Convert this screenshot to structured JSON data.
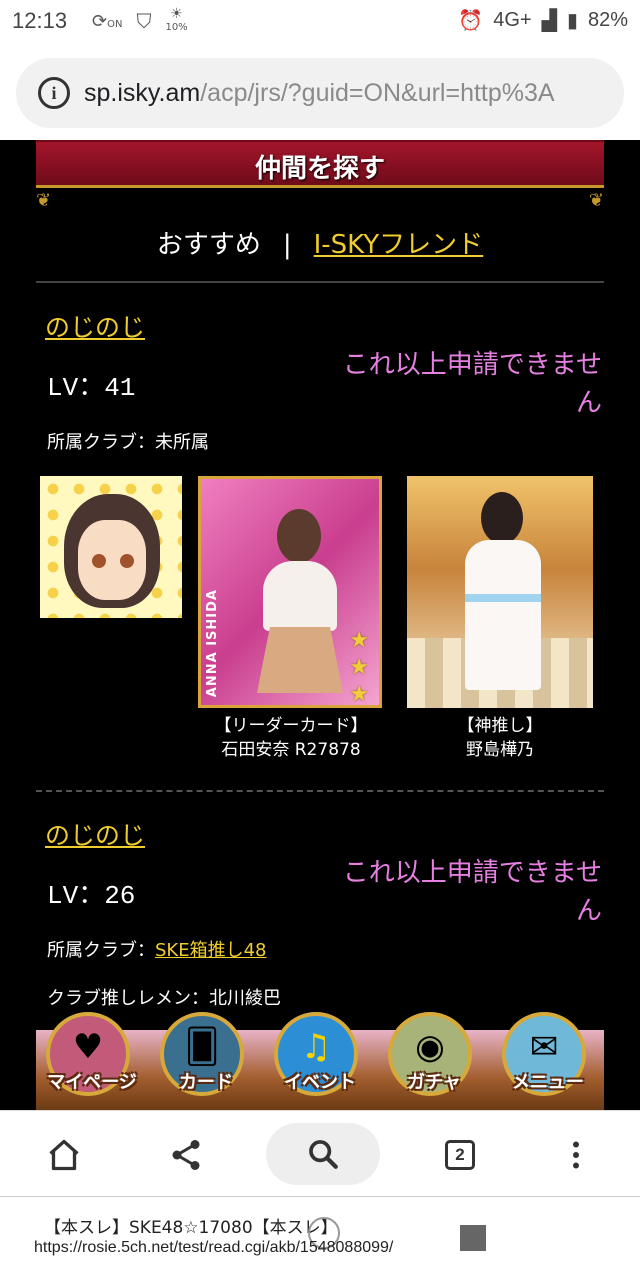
{
  "status_bar": {
    "time": "12:13",
    "data_badge": "ON",
    "brightness": "10%",
    "network": "4G+",
    "battery": "82%"
  },
  "browser": {
    "url_host": "sp.isky.am",
    "url_path": "/acp/jrs/?guid=ON&url=http%3A",
    "tab_count": "2"
  },
  "page": {
    "banner_title": "仲間を探す",
    "tabs": {
      "recommended": "おすすめ",
      "separator": "|",
      "friend": "I-SKYフレンド"
    },
    "members": [
      {
        "name": "のじのじ",
        "level": "LV：41",
        "status": "これ以上申請できません",
        "club_label": "所属クラブ：",
        "club_value": "未所属",
        "leader_caption_1": "【リーダーカード】",
        "leader_caption_2": "石田安奈 R27878",
        "leader_card_name": "ANNA ISHIDA",
        "oshi_caption_1": "【神推し】",
        "oshi_caption_2": "野島樺乃"
      },
      {
        "name": "のじのじ",
        "level": "LV：26",
        "status": "これ以上申請できません",
        "club_label": "所属クラブ：",
        "club_value": "SKE箱推し48",
        "oshimen_label": "クラブ推しレメン：",
        "oshimen_value": "北川綾巴"
      }
    ],
    "game_nav": [
      {
        "label": "マイページ",
        "icon": "heart-icon",
        "color": "#c25a7a"
      },
      {
        "label": "カード",
        "icon": "cards-icon",
        "color": "#3b6f8f"
      },
      {
        "label": "イベント",
        "icon": "music-note-icon",
        "color": "#2c8fd6"
      },
      {
        "label": "ガチャ",
        "icon": "crystal-ball-icon",
        "color": "#a8b37a"
      },
      {
        "label": "メニュー",
        "icon": "menu-scroll-icon",
        "color": "#6fb8d8"
      }
    ]
  },
  "overlay": {
    "title": "【本スレ】SKE48☆17080【本スレ】",
    "url": "https://rosie.5ch.net/test/read.cgi/akb/1548088099/"
  }
}
